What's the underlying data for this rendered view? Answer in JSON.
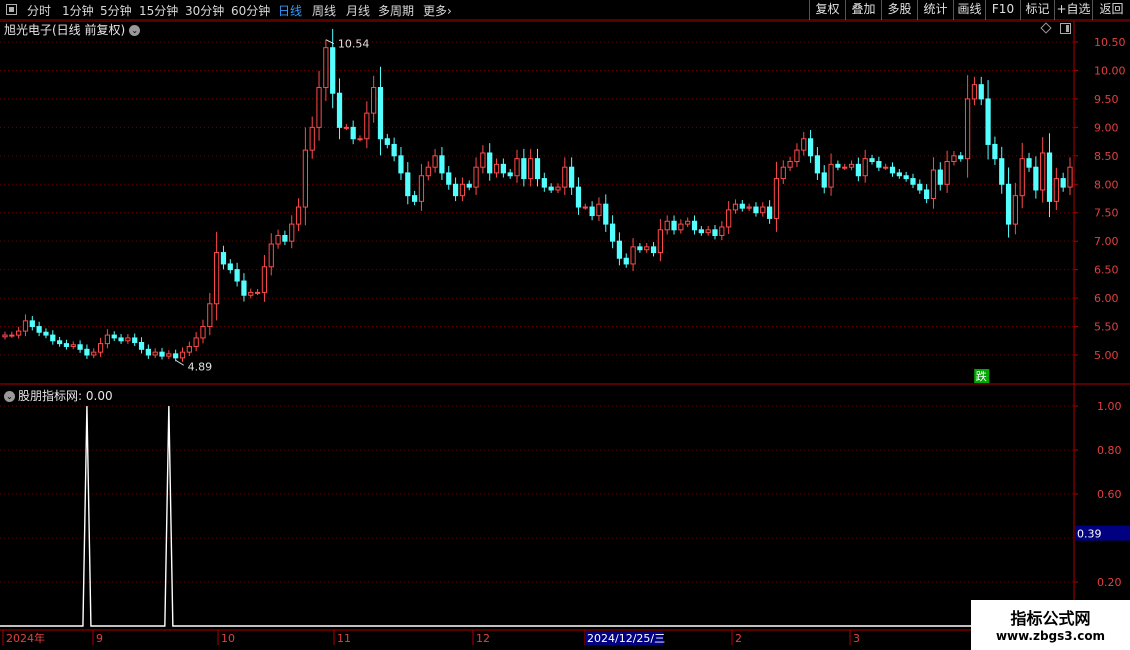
{
  "toolbar": {
    "timeframes": [
      "分时",
      "1分钟",
      "5分钟",
      "15分钟",
      "30分钟",
      "60分钟",
      "日线",
      "周线",
      "月线",
      "多周期",
      "更多"
    ],
    "active_timeframe": "日线",
    "more_chevron": "›",
    "right_buttons": [
      "复权",
      "叠加",
      "多股",
      "统计",
      "画线",
      "F10",
      "标记",
      "+自选",
      "返回"
    ]
  },
  "price_chart": {
    "title": "旭光电子(日线 前复权)",
    "high_label": "10.54",
    "low_label": "4.89",
    "signal_badge": "跌",
    "y_ticks": [
      "10.50",
      "10.00",
      "9.50",
      "9.00",
      "8.50",
      "8.00",
      "7.50",
      "7.00",
      "6.50",
      "6.00",
      "5.50",
      "5.00"
    ]
  },
  "indicator": {
    "title": "股朋指标网",
    "value_label": ": 0.00",
    "y_ticks": [
      "1.00",
      "0.80",
      "0.60",
      "0.20"
    ],
    "cursor_value": "0.39"
  },
  "x_axis": {
    "labels": [
      "2024年",
      "9",
      "10",
      "11",
      "12",
      "2024/12/25/三",
      "2",
      "3"
    ]
  },
  "watermark": {
    "line1": "指标公式网",
    "line2": "www.zbgs3.com"
  },
  "colors": {
    "up": "#ff4a4a",
    "down": "#54ffff",
    "axis": "#b00000",
    "grid": "#6a0000",
    "active": "#3399ff"
  },
  "chart_data": [
    {
      "type": "candlestick",
      "title": "旭光电子(日线 前复权)",
      "ylim": [
        4.7,
        10.8
      ],
      "y_ticks": [
        10.5,
        10.0,
        9.5,
        9.0,
        8.5,
        8.0,
        7.5,
        7.0,
        6.5,
        6.0,
        5.5,
        5.0
      ],
      "high": 10.54,
      "low": 4.89,
      "close": [
        5.35,
        5.35,
        5.42,
        5.6,
        5.5,
        5.4,
        5.35,
        5.25,
        5.2,
        5.15,
        5.18,
        5.1,
        5.0,
        5.05,
        5.2,
        5.35,
        5.3,
        5.25,
        5.3,
        5.22,
        5.1,
        5.0,
        5.05,
        4.98,
        5.02,
        4.95,
        5.05,
        5.15,
        5.3,
        5.5,
        5.9,
        6.8,
        6.6,
        6.5,
        6.3,
        6.05,
        6.1,
        6.1,
        6.55,
        6.95,
        7.1,
        7.0,
        7.3,
        7.6,
        8.6,
        9.0,
        9.7,
        10.4,
        9.6,
        9.0,
        9.0,
        8.8,
        8.8,
        9.25,
        9.7,
        8.8,
        8.7,
        8.5,
        8.2,
        7.8,
        7.7,
        8.15,
        8.3,
        8.5,
        8.2,
        8.0,
        7.8,
        8.0,
        7.95,
        8.3,
        8.55,
        8.2,
        8.35,
        8.2,
        8.15,
        8.45,
        8.1,
        8.45,
        8.1,
        7.95,
        7.9,
        7.95,
        8.3,
        7.95,
        7.6,
        7.6,
        7.45,
        7.65,
        7.3,
        7.0,
        6.7,
        6.6,
        6.9,
        6.85,
        6.9,
        6.8,
        7.2,
        7.35,
        7.2,
        7.3,
        7.35,
        7.2,
        7.15,
        7.2,
        7.1,
        7.25,
        7.55,
        7.65,
        7.58,
        7.6,
        7.5,
        7.6,
        7.4,
        8.1,
        8.3,
        8.4,
        8.6,
        8.8,
        8.5,
        8.2,
        7.95,
        8.35,
        8.3,
        8.3,
        8.35,
        8.15,
        8.45,
        8.4,
        8.3,
        8.3,
        8.2,
        8.15,
        8.1,
        8.0,
        7.9,
        7.75,
        8.25,
        8.0,
        8.4,
        8.5,
        8.45,
        9.5,
        9.75,
        9.5,
        8.7,
        8.45,
        8.0,
        7.3,
        7.8,
        8.45,
        8.3,
        7.9,
        8.55,
        7.7,
        8.1,
        7.95,
        8.3
      ],
      "up_color": "#ff4a4a",
      "down_color": "#54ffff"
    },
    {
      "type": "line",
      "title": "股朋指标网",
      "ylim": [
        0,
        1.1
      ],
      "y_ticks": [
        1.0,
        0.8,
        0.6,
        0.2
      ],
      "spikes_at_candle_index": [
        12,
        24
      ],
      "baseline": 0.0,
      "spike_value": 1.0,
      "color": "#ffffff"
    }
  ]
}
